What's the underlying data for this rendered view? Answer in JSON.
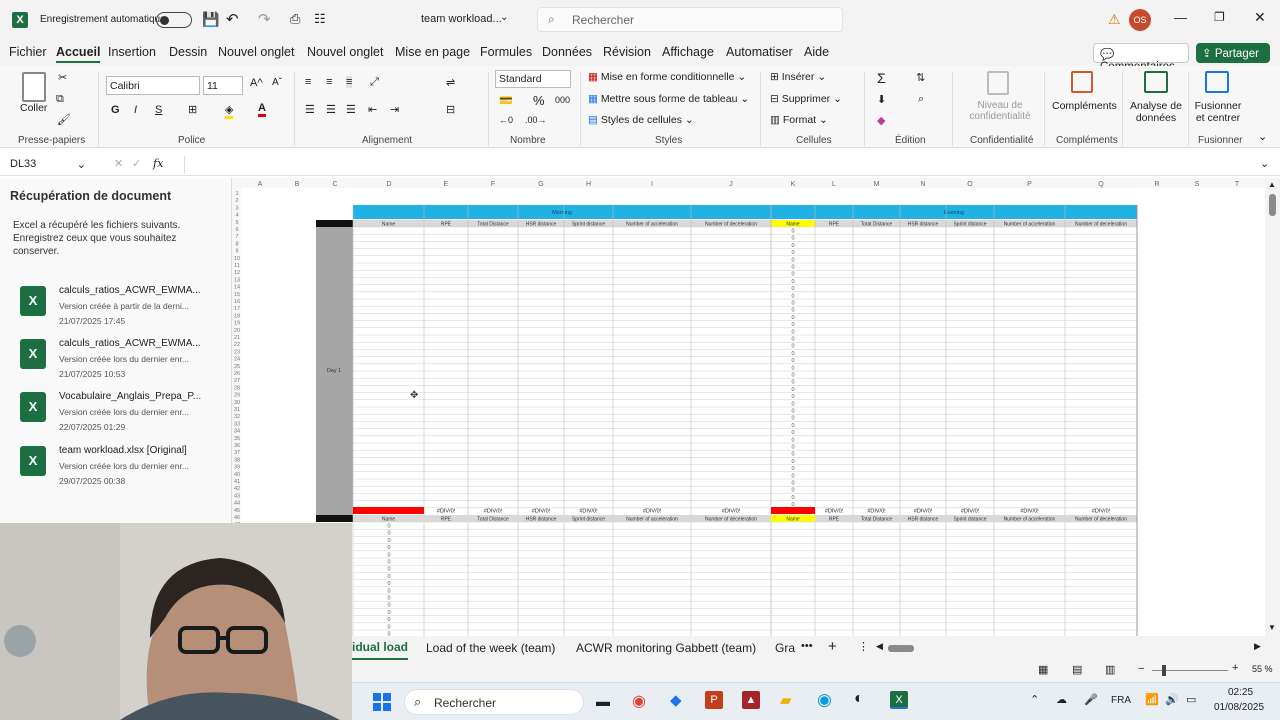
{
  "titlebar": {
    "autosave": "Enregistrement automatique",
    "filename": "team workload...",
    "search_placeholder": "Rechercher",
    "user_initials": "OS"
  },
  "menu": {
    "items": [
      "Fichier",
      "Accueil",
      "Insertion",
      "Dessin",
      "Nouvel onglet",
      "Nouvel onglet",
      "Mise en page",
      "Formules",
      "Données",
      "Révision",
      "Affichage",
      "Automatiser",
      "Aide"
    ],
    "comments": "Commentaires",
    "share": "Partager"
  },
  "ribbon": {
    "paste": "Coller",
    "clipboard_group": "Presse-papiers",
    "font_name": "Calibri",
    "font_size": "11",
    "police_group": "Police",
    "alignment_group": "Alignement",
    "number_format": "Standard",
    "number_group": "Nombre",
    "cond_format": "Mise en forme conditionnelle",
    "format_table": "Mettre sous forme de tableau",
    "cell_styles": "Styles de cellules",
    "styles_group": "Styles",
    "insert": "Insérer",
    "delete": "Supprimer",
    "format": "Format",
    "cells_group": "Cellules",
    "edition_group": "Édition",
    "sensitivity": "Niveau de confidentialité",
    "conf_group": "Confidentialité",
    "addins": "Compléments",
    "addins_group": "Compléments",
    "analyze": "Analyse de données",
    "merge": "Fusionner et centrer",
    "merge_group": "Fusionner"
  },
  "formula_bar": {
    "name_box": "DL33",
    "fx": "fx"
  },
  "recovery": {
    "title": "Récupération de document",
    "description": "Excel a récupéré les fichiers suivants. Enregistrez ceux que vous souhaitez conserver.",
    "files": [
      {
        "name": "calculs_ratios_ACWR_EWMA...",
        "note": "Version créée à partir de la derni...",
        "date": "21/07/2025 17:45"
      },
      {
        "name": "calculs_ratios_ACWR_EWMA...",
        "note": "Version créée lors du dernier enr...",
        "date": "21/07/2025 10:53"
      },
      {
        "name": "Vocabulaire_Anglais_Prepa_P...",
        "note": "Version créée lors du dernier enr...",
        "date": "22/07/2025 01:29"
      },
      {
        "name": "team workload.xlsx [Original]",
        "note": "Version créée lors du dernier enr...",
        "date": "29/07/2025 00:38"
      }
    ]
  },
  "grid": {
    "columns": [
      "A",
      "B",
      "C",
      "D",
      "E",
      "F",
      "G",
      "H",
      "I",
      "J",
      "K",
      "L",
      "M",
      "N",
      "O",
      "P",
      "Q",
      "R",
      "S",
      "T"
    ],
    "morning": "Morning",
    "evening": "Evening",
    "headers": [
      "Name",
      "RPE",
      "Total Distance",
      "HSR distance",
      "Sprint distance",
      "Number of acceleration",
      "Number of deceleration"
    ],
    "day_label": "Day 1",
    "zero": "0",
    "div_error": "#DIV/0!"
  },
  "sheet_tabs": [
    "idual load",
    "Load of the week (team)",
    "ACWR monitoring Gabbett (team)",
    "Gra"
  ],
  "status": {
    "zoom": "55 %"
  },
  "taskbar": {
    "search": "Rechercher",
    "lang": "FRA",
    "time": "02:25",
    "date": "01/08/2025"
  },
  "colors": {
    "excel_green": "#1d6f42",
    "header_blue": "#1fb2e3",
    "name_yellow": "#ffff00",
    "error_red": "#ff0000"
  }
}
